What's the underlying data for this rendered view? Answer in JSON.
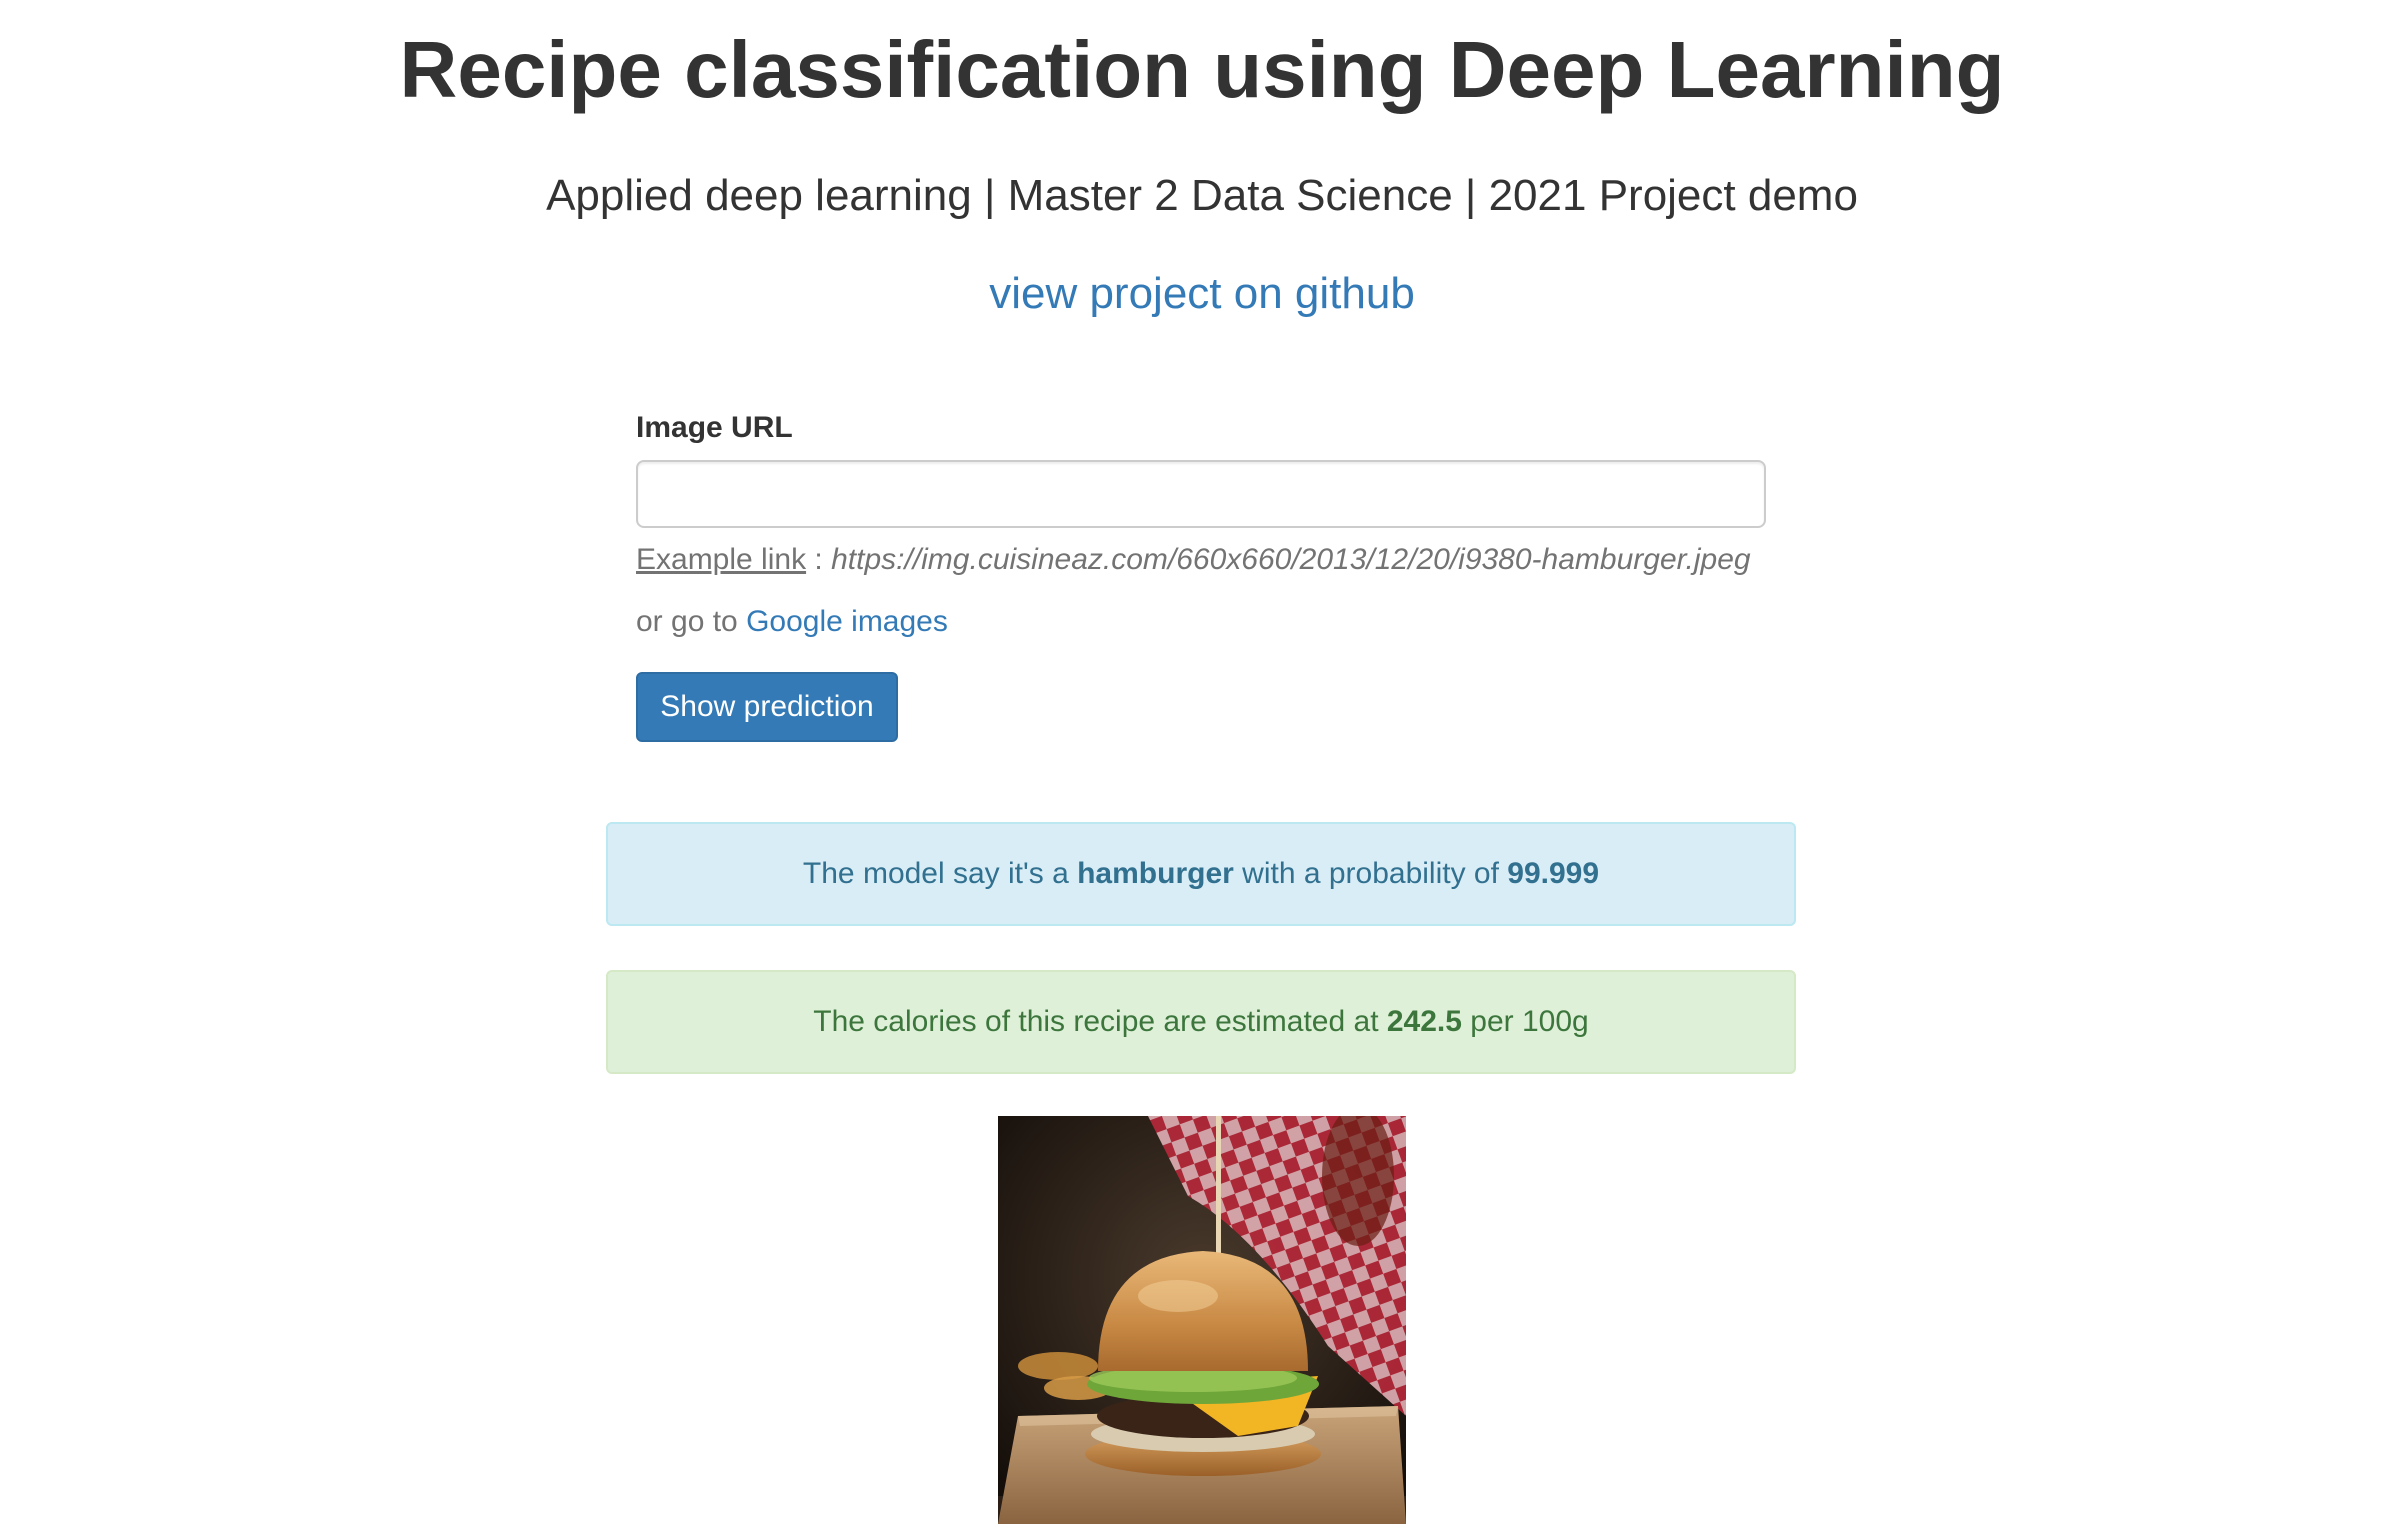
{
  "header": {
    "title": "Recipe classification using Deep Learning",
    "subtitle": "Applied deep learning | Master 2 Data Science | 2021 Project demo",
    "github_link": "view project on github"
  },
  "form": {
    "image_url_label": "Image URL",
    "image_url_value": "",
    "image_url_placeholder": "",
    "example_link_label": "Example link",
    "example_separator": " : ",
    "example_url": "https://img.cuisineaz.com/660x660/2013/12/20/i9380-hamburger.jpeg",
    "google_prefix": "or go to ",
    "google_link": "Google images",
    "submit_label": "Show prediction"
  },
  "prediction": {
    "prefix": "The model say it's a ",
    "label": "hamburger",
    "middle": " with a probability of ",
    "probability": "99.999"
  },
  "calories": {
    "prefix": "The calories of this recipe are estimated at ",
    "value": "242.5",
    "suffix": " per 100g"
  },
  "colors": {
    "link": "#337ab7",
    "button": "#337ab7",
    "info_bg": "#d9edf7",
    "info_text": "#31708f",
    "success_bg": "#dff0d8",
    "success_text": "#3c763d"
  },
  "image": {
    "subject": "hamburger-photo"
  }
}
